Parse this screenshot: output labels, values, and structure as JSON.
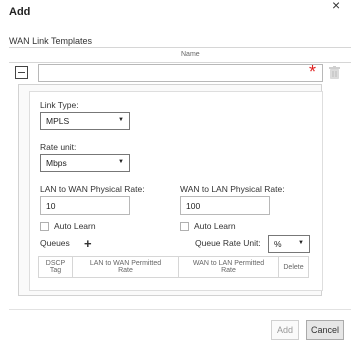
{
  "dialog": {
    "title": "Add",
    "close_glyph": "×",
    "section_label": "WAN Link Templates",
    "column_header": "Name",
    "name_value": "",
    "required_marker": "*",
    "icons": {
      "collapse": "minus-box-icon",
      "delete": "trash-icon",
      "add_queue": "plus-icon"
    },
    "colors": {
      "required": "#e02020"
    }
  },
  "link_type": {
    "label": "Link Type:",
    "selected": "MPLS"
  },
  "rate_unit": {
    "label": "Rate unit:",
    "selected": "Mbps"
  },
  "lan_to_wan": {
    "label": "LAN to WAN Physical Rate:",
    "value": "10",
    "auto_learn": "Auto Learn"
  },
  "wan_to_lan": {
    "label": "WAN to LAN Physical Rate:",
    "value": "100",
    "auto_learn": "Auto Learn"
  },
  "queues": {
    "label": "Queues",
    "add_glyph": "+",
    "rate_unit_label": "Queue Rate Unit:",
    "rate_unit_selected": "%",
    "columns": {
      "dscp_1": "DSCP",
      "dscp_2": "Tag",
      "lan_1": "LAN to WAN Permitted",
      "lan_2": "Rate",
      "wan_1": "WAN to LAN Permitted",
      "wan_2": "Rate",
      "delete": "Delete"
    }
  },
  "footer": {
    "add_label": "Add",
    "cancel_label": "Cancel"
  }
}
